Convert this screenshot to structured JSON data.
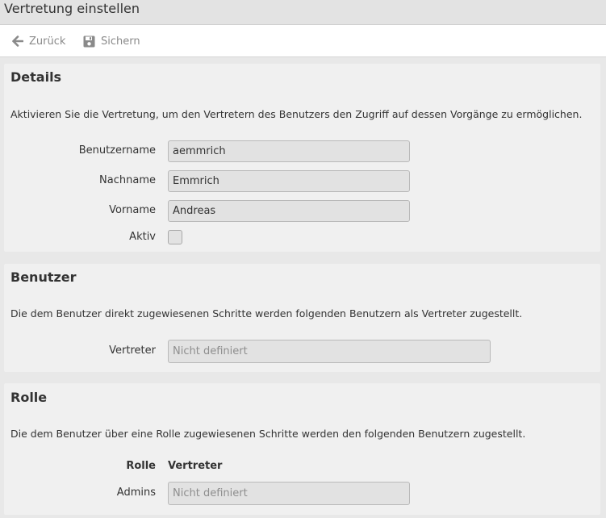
{
  "window": {
    "title": "Vertretung einstellen"
  },
  "toolbar": {
    "back": {
      "label": "Zurück",
      "icon": "arrow-left-icon"
    },
    "save": {
      "label": "Sichern",
      "icon": "floppy-disk-icon"
    }
  },
  "details": {
    "heading": "Details",
    "description": "Aktivieren Sie die Vertretung, um den Vertretern des Benutzers den Zugriff auf dessen Vorgänge zu ermöglichen.",
    "username_label": "Benutzername",
    "username_value": "aemmrich",
    "lastname_label": "Nachname",
    "lastname_value": "Emmrich",
    "firstname_label": "Vorname",
    "firstname_value": "Andreas",
    "active_label": "Aktiv",
    "active_checked": false
  },
  "user_section": {
    "heading": "Benutzer",
    "description": "Die dem Benutzer direkt zugewiesenen Schritte werden folgenden Benutzern als Vertreter zugestellt.",
    "deputy_label": "Vertreter",
    "deputy_placeholder": "Nicht definiert"
  },
  "role_section": {
    "heading": "Rolle",
    "description": "Die dem Benutzer über eine Rolle zugewiesenen Schritte werden den folgenden Benutzern zugestellt.",
    "col_role": "Rolle",
    "col_deputy": "Vertreter",
    "rows": [
      {
        "role": "Admins",
        "deputy_placeholder": "Nicht definiert"
      }
    ]
  },
  "colors": {
    "panel_bg": "#f0f0f0",
    "field_bg": "#e2e2e2",
    "toolbar_text": "#8a8a8a"
  }
}
